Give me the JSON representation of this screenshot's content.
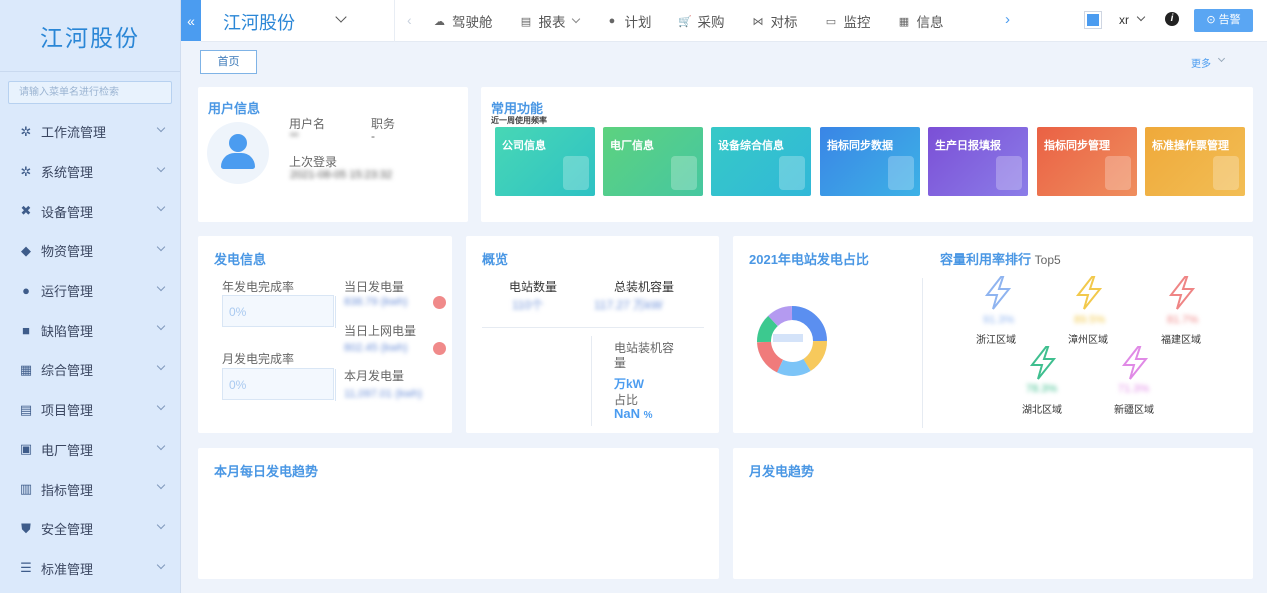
{
  "sidebar": {
    "logo": "江河股份",
    "search_placeholder": "请输入菜单名进行检索",
    "items": [
      {
        "label": "工作流管理",
        "icon": "gear-icon"
      },
      {
        "label": "系统管理",
        "icon": "gear-icon"
      },
      {
        "label": "设备管理",
        "icon": "tools-icon"
      },
      {
        "label": "物资管理",
        "icon": "cube-icon"
      },
      {
        "label": "运行管理",
        "icon": "compass-icon"
      },
      {
        "label": "缺陷管理",
        "icon": "report-icon"
      },
      {
        "label": "综合管理",
        "icon": "grid-icon"
      },
      {
        "label": "项目管理",
        "icon": "folder-icon"
      },
      {
        "label": "电厂管理",
        "icon": "plant-icon"
      },
      {
        "label": "指标管理",
        "icon": "document-icon"
      },
      {
        "label": "安全管理",
        "icon": "shield-icon"
      },
      {
        "label": "标准管理",
        "icon": "list-icon"
      }
    ]
  },
  "header": {
    "collapse_icon": "«",
    "title": "江河股份",
    "nav": [
      {
        "label": "驾驶舱",
        "icon": "dashboard-icon",
        "dropdown": false
      },
      {
        "label": "报表",
        "icon": "report-icon",
        "dropdown": true
      },
      {
        "label": "计划",
        "icon": "clock-icon",
        "dropdown": false
      },
      {
        "label": "采购",
        "icon": "cart-icon",
        "dropdown": false
      },
      {
        "label": "对标",
        "icon": "compare-icon",
        "dropdown": false
      },
      {
        "label": "监控",
        "icon": "monitor-icon",
        "dropdown": false
      },
      {
        "label": "信息",
        "icon": "info-doc-icon",
        "dropdown": false
      }
    ],
    "user": "xr",
    "info": "i",
    "alarm": "告警"
  },
  "tabs": {
    "home": "首页",
    "more": "更多"
  },
  "user_info": {
    "title": "用户信息",
    "username_label": "用户名",
    "username_value": "**",
    "role_label": "职务",
    "role_value": "-",
    "last_login_label": "上次登录",
    "last_login_value": "2021-08-05 15:23:32"
  },
  "common": {
    "title": "常用功能",
    "subtitle": "近一周使用频率",
    "tiles": [
      {
        "label": "公司信息",
        "color": "#3fcfb6"
      },
      {
        "label": "电厂信息",
        "color": "#52cc7f"
      },
      {
        "label": "设备综合信息",
        "color": "#2ec6c6"
      },
      {
        "label": "指标同步数据",
        "color": "#3f8ee8"
      },
      {
        "label": "生产日报填报",
        "color": "#7a56d6"
      },
      {
        "label": "指标同步管理",
        "color": "#ea6f4d"
      },
      {
        "label": "标准操作票管理",
        "color": "#efae3e"
      }
    ]
  },
  "power": {
    "title": "发电信息",
    "year_label": "年发电完成率",
    "year_value": "0%",
    "month_label": "月发电完成率",
    "month_value": "0%",
    "today_label": "当日发电量",
    "today_value": "838.79 (kwh)",
    "online_label": "当日上网电量",
    "online_value": "802.45 (kwh)",
    "month_gen_label": "本月发电量",
    "month_gen_value": "11,097.01 (kwh)"
  },
  "overview": {
    "title": "概览",
    "station_label": "电站数量",
    "station_value": "110个",
    "capacity_label": "总装机容量",
    "capacity_value": "117.27 万kW",
    "install_label": "电站装机容量",
    "install_unit": "万kW",
    "ratio_label": "占比",
    "ratio_value": "NaN",
    "ratio_unit": "%"
  },
  "station_share": {
    "title": "2021年电站发电占比"
  },
  "ranking": {
    "title": "容量利用率排行",
    "suffix": "Top5",
    "items": [
      {
        "name": "浙江区域",
        "value": "91.3%",
        "color": "#8fb4f0"
      },
      {
        "name": "漳州区域",
        "value": "89.5%",
        "color": "#f2c94c"
      },
      {
        "name": "福建区域",
        "value": "81.7%",
        "color": "#ef8585"
      },
      {
        "name": "湖北区域",
        "value": "78.3%",
        "color": "#3fbf8f"
      },
      {
        "name": "新疆区域",
        "value": "71.3%",
        "color": "#e08ae6"
      }
    ]
  },
  "trend_daily": {
    "title": "本月每日发电趋势"
  },
  "trend_monthly": {
    "title": "月发电趋势"
  }
}
